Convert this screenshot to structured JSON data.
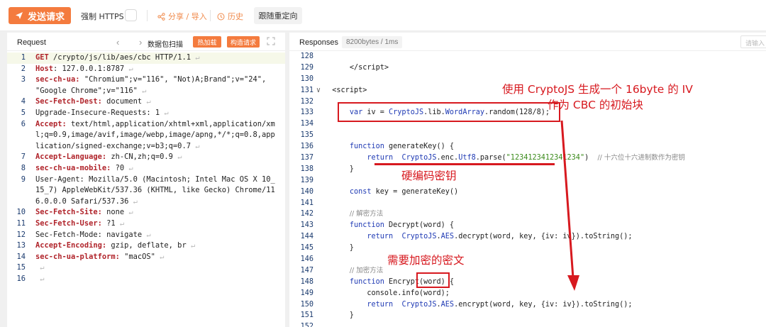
{
  "toolbar": {
    "send_label": "发送请求",
    "https_label": "强制 HTTPS",
    "share_label": "分享 / 导入",
    "history_label": "历史",
    "redirect_label": "跟随重定向"
  },
  "request_panel": {
    "title": "Request",
    "scan_label": "数据包扫描",
    "hot_label": "热加载",
    "build_label": "构造请求",
    "lines": [
      {
        "n": "1",
        "k": "GET",
        "v": " /crypto/js/lib/aes/cbc HTTP/1.1"
      },
      {
        "n": "2",
        "k": "Host",
        "v": ": 127.0.0.1:8787"
      },
      {
        "n": "3",
        "k": "sec-ch-ua:",
        "v": " \"Chromium\";v=\"116\", \"Not)A;Brand\";v=\"24\", \"Google Chrome\";v=\"116\""
      },
      {
        "n": "4",
        "k": "Sec-Fetch-Dest:",
        "v": " document"
      },
      {
        "n": "5",
        "k": "",
        "v": "Upgrade-Insecure-Requests: 1"
      },
      {
        "n": "6",
        "k": "Accept:",
        "v": " text/html,application/xhtml+xml,application/xml;q=0.9,image/avif,image/webp,image/apng,*/*;q=0.8,application/signed-exchange;v=b3;q=0.7"
      },
      {
        "n": "7",
        "k": "Accept-Language:",
        "v": " zh-CN,zh;q=0.9"
      },
      {
        "n": "8",
        "k": "sec-ch-ua-mobile:",
        "v": " ?0"
      },
      {
        "n": "9",
        "k": "",
        "v": "User-Agent: Mozilla/5.0 (Macintosh; Intel Mac OS X 10_15_7) AppleWebKit/537.36 (KHTML, like Gecko) Chrome/116.0.0.0 Safari/537.36"
      },
      {
        "n": "10",
        "k": "Sec-Fetch-Site:",
        "v": " none"
      },
      {
        "n": "11",
        "k": "Sec-Fetch-User:",
        "v": " ?1"
      },
      {
        "n": "12",
        "k": "",
        "v": "Sec-Fetch-Mode: navigate"
      },
      {
        "n": "13",
        "k": "Accept-Encoding:",
        "v": " gzip, deflate, br"
      },
      {
        "n": "14",
        "k": "sec-ch-ua-platform:",
        "v": " \"macOS\""
      },
      {
        "n": "15",
        "k": "",
        "v": ""
      },
      {
        "n": "16",
        "k": "",
        "v": ""
      }
    ]
  },
  "response_panel": {
    "title": "Responses",
    "badge": "8200bytes / 1ms",
    "search_placeholder": "请输入",
    "lines": [
      {
        "n": "128",
        "html": ""
      },
      {
        "n": "129",
        "html": "    <span class='tag'>&lt;/script&gt;</span>"
      },
      {
        "n": "130",
        "html": ""
      },
      {
        "n": "131",
        "html": "<span class='tag'>&lt;script&gt;</span>",
        "fold": "∨"
      },
      {
        "n": "132",
        "html": ""
      },
      {
        "n": "133",
        "html": "    <span class='kw'>var</span> iv = <span class='fn'>CryptoJS</span>.lib.<span class='fn'>WordArray</span>.random(128/8);"
      },
      {
        "n": "134",
        "html": ""
      },
      {
        "n": "135",
        "html": ""
      },
      {
        "n": "136",
        "html": "    <span class='kw'>function</span> generateKey() {"
      },
      {
        "n": "137",
        "html": "        <span class='kw'>return</span>  <span class='fn'>CryptoJS</span>.enc.<span class='fn'>Utf8</span>.parse(<span class='str'>\"1234123412341234\"</span>)  <span class='cm'>// 十六位十六进制数作为密钥</span>"
      },
      {
        "n": "138",
        "html": "    }"
      },
      {
        "n": "139",
        "html": ""
      },
      {
        "n": "140",
        "html": "    <span class='kw'>const</span> key = generateKey()"
      },
      {
        "n": "141",
        "html": ""
      },
      {
        "n": "142",
        "html": "    <span class='cm'>// 解密方法</span>"
      },
      {
        "n": "143",
        "html": "    <span class='kw'>function</span> Decrypt(word) {"
      },
      {
        "n": "144",
        "html": "        <span class='kw'>return</span>  <span class='fn'>CryptoJS</span>.<span class='fn'>AES</span>.decrypt(word, key, {iv: iv}).toString();"
      },
      {
        "n": "145",
        "html": "    }"
      },
      {
        "n": "146",
        "html": ""
      },
      {
        "n": "147",
        "html": "    <span class='cm'>// 加密方法</span>"
      },
      {
        "n": "148",
        "html": "    <span class='kw'>function</span> Encrypt(word) {"
      },
      {
        "n": "149",
        "html": "        console.info(word);"
      },
      {
        "n": "150",
        "html": "        <span class='kw'>return</span>  <span class='fn'>CryptoJS</span>.<span class='fn'>AES</span>.encrypt(word, key, {iv: iv}).toString();"
      },
      {
        "n": "151",
        "html": "    }"
      },
      {
        "n": "152",
        "html": ""
      }
    ]
  },
  "annotations": {
    "iv_note_line1": "使用 CryptoJS 生成一个 16byte 的 IV",
    "iv_note_line2": "作为 CBC 的初始块",
    "key_note": "硬编码密钥",
    "cipher_note": "需要加密的密文",
    "color": "#d7191f"
  }
}
